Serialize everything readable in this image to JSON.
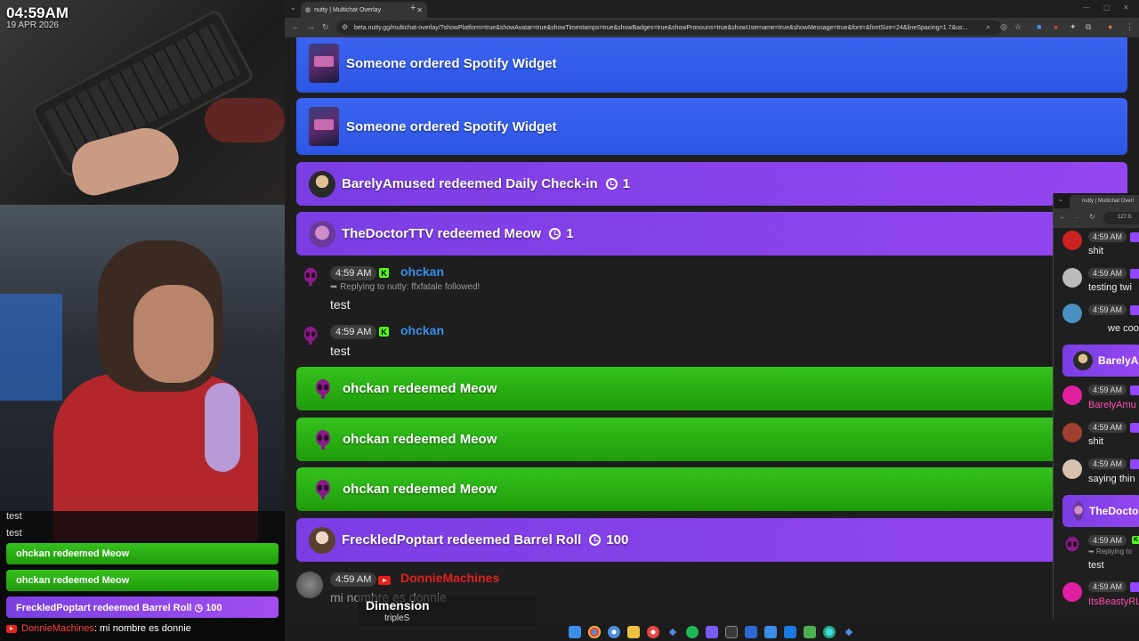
{
  "stream_overlay": {
    "time": "04:59AM",
    "date": "19 APR 2026",
    "chat": {
      "plain": [
        "test",
        "test"
      ],
      "banners": [
        {
          "text": "ohckan redeemed Meow",
          "color": "green"
        },
        {
          "text": "ohckan redeemed Meow",
          "color": "green"
        },
        {
          "text": "FreckledPoptart redeemed Barrel Roll ◷ 100",
          "color": "purple"
        }
      ],
      "yt_user": "DonnieMachines",
      "yt_message": ": mi nombre es donnie"
    }
  },
  "browser": {
    "tab_title": "nutty | Multichat Overlay",
    "url": "beta.nutty.gg/multichat-overlay/?showPlatform=true&showAvatar=true&showTimestamps=true&showBadges=true&showPronouns=true&showUsername=true&showMessage=true&font=&fontSize=24&lineSpacing=1.7&us...",
    "events": [
      {
        "type": "banner",
        "color": "blue",
        "text": "Someone ordered Spotify Widget"
      },
      {
        "type": "banner",
        "color": "blue",
        "text": "Someone ordered Spotify Widget"
      },
      {
        "type": "redeem",
        "user": "BarelyAmused",
        "text": "BarelyAmused redeemed Daily Check-in",
        "cost": "1"
      },
      {
        "type": "redeem",
        "user": "TheDoctorTTV",
        "text": "TheDoctorTTV redeemed Meow",
        "cost": "1"
      },
      {
        "type": "message",
        "time": "4:59 AM",
        "platform": "kick",
        "user": "ohckan",
        "reply": "➥ Replying to nutty: ffxfatale followed!",
        "text": "test"
      },
      {
        "type": "message",
        "time": "4:59 AM",
        "platform": "kick",
        "user": "ohckan",
        "text": "test"
      },
      {
        "type": "banner",
        "color": "green",
        "text": "ohckan redeemed Meow"
      },
      {
        "type": "banner",
        "color": "green",
        "text": "ohckan redeemed Meow"
      },
      {
        "type": "banner",
        "color": "green",
        "text": "ohckan redeemed Meow"
      },
      {
        "type": "redeem",
        "user": "FreckledPoptart",
        "text": "FreckledPoptart redeemed Barrel Roll",
        "cost": "100"
      },
      {
        "type": "message",
        "time": "4:59 AM",
        "platform": "youtube",
        "user": "DonnieMachines",
        "text": "mi nombre es donnie"
      }
    ]
  },
  "mini_window": {
    "tab_title": "nutty | Multichat Overl",
    "url": "127.0.",
    "items": [
      {
        "time": "4:59 AM",
        "text": "shit"
      },
      {
        "time": "4:59 AM",
        "text": "testing twi"
      },
      {
        "time": "4:59 AM",
        "text": "we coo"
      },
      {
        "banner": "BarelyAr"
      },
      {
        "time": "4:59 AM",
        "user": "BarelyAmu"
      },
      {
        "time": "4:59 AM",
        "text": "shit"
      },
      {
        "time": "4:59 AM",
        "text": "saying thin"
      },
      {
        "banner": "TheDoctor"
      },
      {
        "time": "4:59 AM",
        "reply": "➥ Replying to",
        "text": "test"
      },
      {
        "time": "4:59 AM",
        "user": "ItsBeastyRL"
      }
    ]
  },
  "now_playing": {
    "title": "Dimension",
    "artist": "tripleS"
  },
  "colors": {
    "blue": "#2d56e6",
    "purple": "#8a44ea",
    "green": "#22a010",
    "kick": "#53fc18",
    "youtube": "#e62117",
    "twitch": "#9146ff"
  }
}
